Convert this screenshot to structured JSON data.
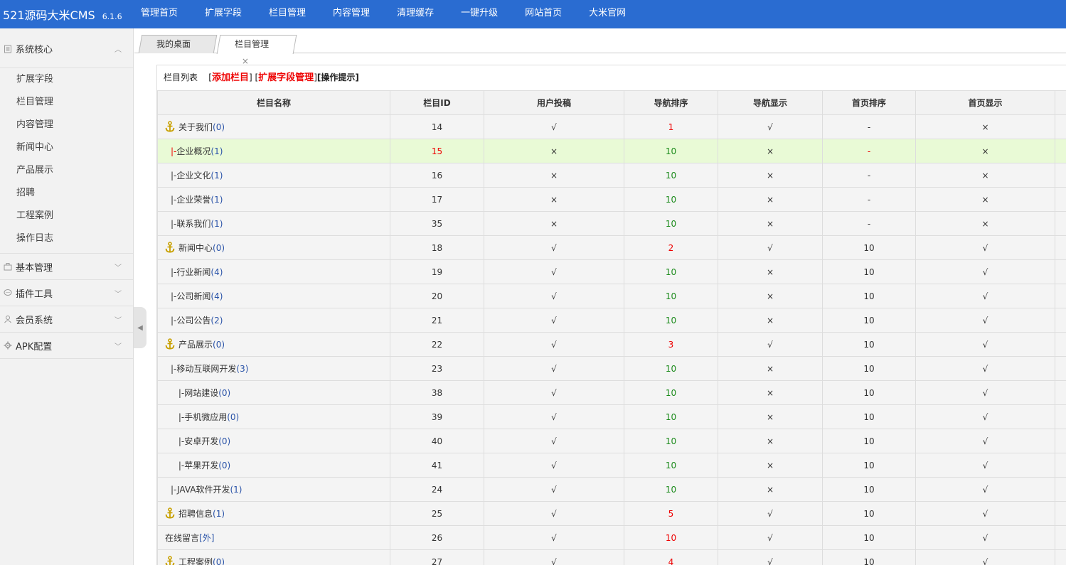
{
  "app": {
    "name": "521源码大米CMS",
    "version": "6.1.6"
  },
  "topnav": [
    "管理首页",
    "扩展字段",
    "栏目管理",
    "内容管理",
    "清理缓存",
    "一键升级",
    "网站首页",
    "大米官网"
  ],
  "sidebar": {
    "groups": [
      {
        "label": "系统核心",
        "icon": "document-icon",
        "expanded": true,
        "items": [
          "扩展字段",
          "栏目管理",
          "内容管理",
          "新闻中心",
          "产品展示",
          "招聘",
          "工程案例",
          "操作日志"
        ]
      },
      {
        "label": "基本管理",
        "icon": "briefcase-icon",
        "expanded": false
      },
      {
        "label": "插件工具",
        "icon": "chat-icon",
        "expanded": false
      },
      {
        "label": "会员系统",
        "icon": "user-icon",
        "expanded": false
      },
      {
        "label": "APK配置",
        "icon": "gear-icon",
        "expanded": false
      }
    ]
  },
  "tabs": [
    {
      "label": "我的桌面",
      "active": false
    },
    {
      "label": "栏目管理",
      "active": true,
      "close": "×"
    }
  ],
  "toolbar": {
    "title": "栏目列表",
    "add_label": "添加栏目",
    "ext_label": "扩展字段管理",
    "tip_label": "[操作提示]"
  },
  "table": {
    "headers": [
      "栏目名称",
      "栏目ID",
      "用户投稿",
      "导航排序",
      "导航显示",
      "首页排序",
      "首页显示"
    ],
    "rows": [
      {
        "anchor": true,
        "prefix": "",
        "name": "关于我们",
        "count": "(0)",
        "id": "14",
        "submit": "√",
        "nav_order": "1",
        "nav_order_color": "red",
        "nav_show": "√",
        "home_order": "-",
        "home_show": "×"
      },
      {
        "anchor": false,
        "prefix": "|-",
        "name": "企业概况",
        "count": "(1)",
        "id": "15",
        "submit": "×",
        "nav_order": "10",
        "nav_order_color": "green",
        "nav_show": "×",
        "home_order": "-",
        "home_show": "×",
        "highlight": true
      },
      {
        "anchor": false,
        "prefix": "|-",
        "name": "企业文化",
        "count": "(1)",
        "id": "16",
        "submit": "×",
        "nav_order": "10",
        "nav_order_color": "green",
        "nav_show": "×",
        "home_order": "-",
        "home_show": "×"
      },
      {
        "anchor": false,
        "prefix": "|-",
        "name": "企业荣誉",
        "count": "(1)",
        "id": "17",
        "submit": "×",
        "nav_order": "10",
        "nav_order_color": "green",
        "nav_show": "×",
        "home_order": "-",
        "home_show": "×"
      },
      {
        "anchor": false,
        "prefix": "|-",
        "name": "联系我们",
        "count": "(1)",
        "id": "35",
        "submit": "×",
        "nav_order": "10",
        "nav_order_color": "green",
        "nav_show": "×",
        "home_order": "-",
        "home_show": "×"
      },
      {
        "anchor": true,
        "prefix": "",
        "name": "新闻中心",
        "count": "(0)",
        "id": "18",
        "submit": "√",
        "nav_order": "2",
        "nav_order_color": "red",
        "nav_show": "√",
        "home_order": "10",
        "home_show": "√"
      },
      {
        "anchor": false,
        "prefix": "|-",
        "name": "行业新闻",
        "count": "(4)",
        "id": "19",
        "submit": "√",
        "nav_order": "10",
        "nav_order_color": "green",
        "nav_show": "×",
        "home_order": "10",
        "home_show": "√"
      },
      {
        "anchor": false,
        "prefix": "|-",
        "name": "公司新闻",
        "count": "(4)",
        "id": "20",
        "submit": "√",
        "nav_order": "10",
        "nav_order_color": "green",
        "nav_show": "×",
        "home_order": "10",
        "home_show": "√"
      },
      {
        "anchor": false,
        "prefix": "|-",
        "name": "公司公告",
        "count": "(2)",
        "id": "21",
        "submit": "√",
        "nav_order": "10",
        "nav_order_color": "green",
        "nav_show": "×",
        "home_order": "10",
        "home_show": "√"
      },
      {
        "anchor": true,
        "prefix": "",
        "name": "产品展示",
        "count": "(0)",
        "id": "22",
        "submit": "√",
        "nav_order": "3",
        "nav_order_color": "red",
        "nav_show": "√",
        "home_order": "10",
        "home_show": "√"
      },
      {
        "anchor": false,
        "prefix": "|-",
        "name": "移动互联网开发",
        "count": "(3)",
        "id": "23",
        "submit": "√",
        "nav_order": "10",
        "nav_order_color": "green",
        "nav_show": "×",
        "home_order": "10",
        "home_show": "√"
      },
      {
        "anchor": false,
        "prefix": " |-",
        "name": "网站建设",
        "count": "(0)",
        "id": "38",
        "submit": "√",
        "nav_order": "10",
        "nav_order_color": "green",
        "nav_show": "×",
        "home_order": "10",
        "home_show": "√"
      },
      {
        "anchor": false,
        "prefix": " |-",
        "name": "手机微应用",
        "count": "(0)",
        "id": "39",
        "submit": "√",
        "nav_order": "10",
        "nav_order_color": "green",
        "nav_show": "×",
        "home_order": "10",
        "home_show": "√"
      },
      {
        "anchor": false,
        "prefix": " |-",
        "name": "安卓开发",
        "count": "(0)",
        "id": "40",
        "submit": "√",
        "nav_order": "10",
        "nav_order_color": "green",
        "nav_show": "×",
        "home_order": "10",
        "home_show": "√"
      },
      {
        "anchor": false,
        "prefix": " |-",
        "name": "苹果开发",
        "count": "(0)",
        "id": "41",
        "submit": "√",
        "nav_order": "10",
        "nav_order_color": "green",
        "nav_show": "×",
        "home_order": "10",
        "home_show": "√"
      },
      {
        "anchor": false,
        "prefix": "|-",
        "name": "JAVA软件开发",
        "count": "(1)",
        "id": "24",
        "submit": "√",
        "nav_order": "10",
        "nav_order_color": "green",
        "nav_show": "×",
        "home_order": "10",
        "home_show": "√"
      },
      {
        "anchor": true,
        "prefix": "",
        "name": "招聘信息",
        "count": "(1)",
        "id": "25",
        "submit": "√",
        "nav_order": "5",
        "nav_order_color": "red",
        "nav_show": "√",
        "home_order": "10",
        "home_show": "√"
      },
      {
        "anchor": false,
        "prefix": "",
        "name": "在线留言",
        "count": "[外]",
        "id": "26",
        "submit": "√",
        "nav_order": "10",
        "nav_order_color": "red",
        "nav_show": "√",
        "home_order": "10",
        "home_show": "√"
      },
      {
        "anchor": true,
        "prefix": "",
        "name": "工程案例",
        "count": "(0)",
        "id": "27",
        "submit": "√",
        "nav_order": "4",
        "nav_order_color": "red",
        "nav_show": "√",
        "home_order": "10",
        "home_show": "√"
      }
    ]
  },
  "colors": {
    "topbar": "#2a6cd1",
    "red": "#e00",
    "green": "#1a8a1a",
    "highlight_row": "#e9fad6"
  }
}
